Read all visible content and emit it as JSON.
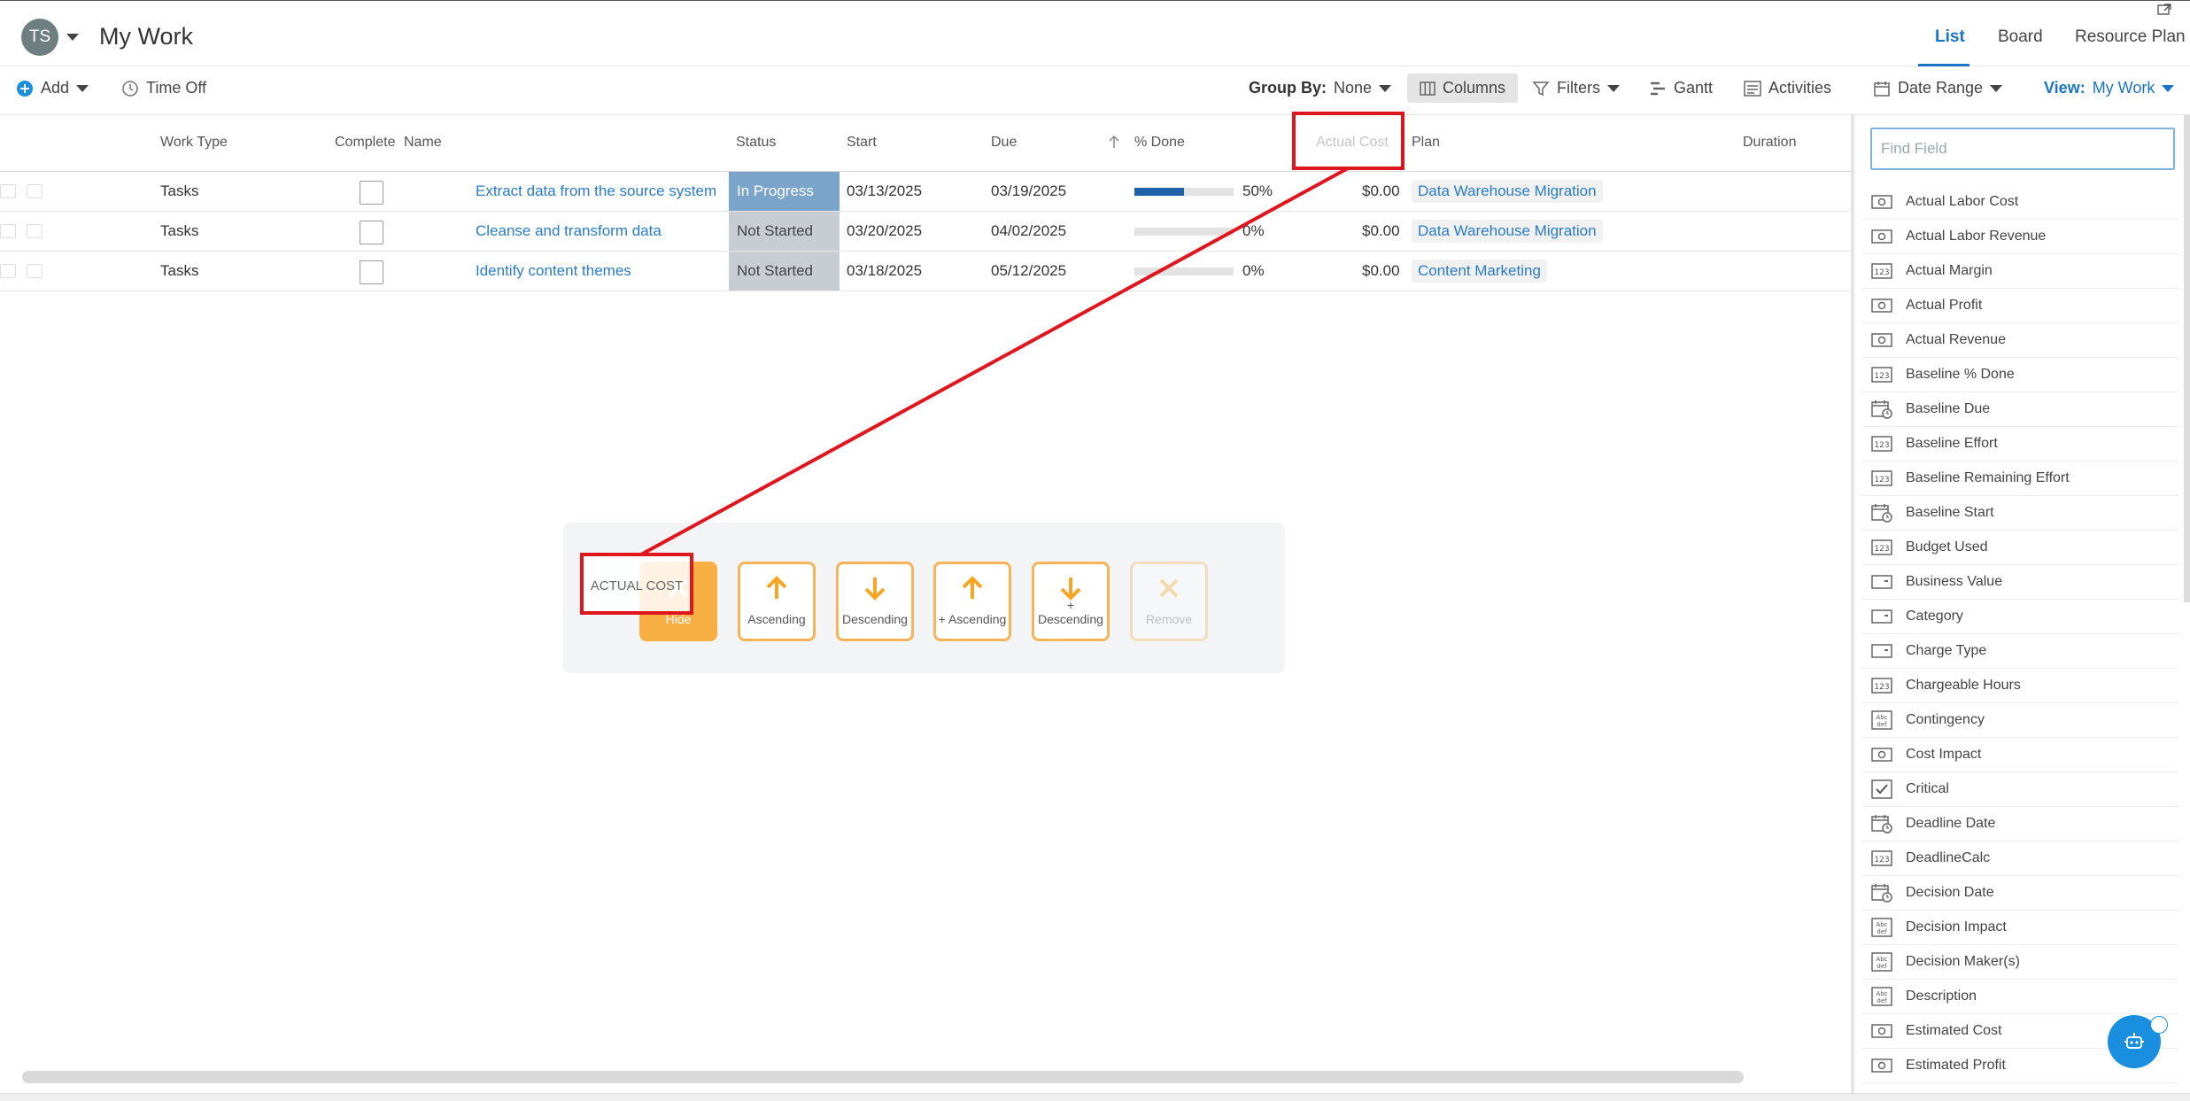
{
  "header": {
    "avatar_initials": "TS",
    "title": "My Work",
    "view_tabs": [
      "List",
      "Board",
      "Resource Plan"
    ],
    "active_tab": "List"
  },
  "toolbar": {
    "add": "Add",
    "time_off": "Time Off",
    "group_by_label": "Group By:",
    "group_by_value": "None",
    "columns": "Columns",
    "filters": "Filters",
    "gantt": "Gantt",
    "activities": "Activities",
    "date_range": "Date Range",
    "view_label": "View:",
    "view_value": "My Work"
  },
  "columns": {
    "work_type": "Work Type",
    "complete": "Complete",
    "name": "Name",
    "status": "Status",
    "start": "Start",
    "due": "Due",
    "pct_done": "% Done",
    "actual_cost": "Actual Cost",
    "plan": "Plan",
    "duration": "Duration"
  },
  "rows": [
    {
      "work_type": "Tasks",
      "name": "Extract data from the source system",
      "status": "In Progress",
      "start": "03/13/2025",
      "due": "03/19/2025",
      "pct": "50%",
      "pct_value": 0.5,
      "cost": "$0.00",
      "plan": "Data Warehouse Migration"
    },
    {
      "work_type": "Tasks",
      "name": "Cleanse and transform data",
      "status": "Not Started",
      "start": "03/20/2025",
      "due": "04/02/2025",
      "pct": "0%",
      "pct_value": 0,
      "cost": "$0.00",
      "plan": "Data Warehouse Migration"
    },
    {
      "work_type": "Tasks",
      "name": "Identify content themes",
      "status": "Not Started",
      "start": "03/18/2025",
      "due": "05/12/2025",
      "pct": "0%",
      "pct_value": 0,
      "cost": "$0.00",
      "plan": "Content Marketing"
    }
  ],
  "field_panel": {
    "search_placeholder": "Find Field",
    "fields": [
      {
        "label": "Actual Labor Cost",
        "icon": "money-icon"
      },
      {
        "label": "Actual Labor Revenue",
        "icon": "money-icon"
      },
      {
        "label": "Actual Margin",
        "icon": "number-icon"
      },
      {
        "label": "Actual Profit",
        "icon": "money-icon"
      },
      {
        "label": "Actual Revenue",
        "icon": "money-icon"
      },
      {
        "label": "Baseline % Done",
        "icon": "number-icon"
      },
      {
        "label": "Baseline Due",
        "icon": "calendar-icon"
      },
      {
        "label": "Baseline Effort",
        "icon": "number-icon"
      },
      {
        "label": "Baseline Remaining Effort",
        "icon": "number-icon"
      },
      {
        "label": "Baseline Start",
        "icon": "calendar-icon"
      },
      {
        "label": "Budget Used",
        "icon": "number-icon"
      },
      {
        "label": "Business Value",
        "icon": "dropdown-icon"
      },
      {
        "label": "Category",
        "icon": "dropdown-icon"
      },
      {
        "label": "Charge Type",
        "icon": "dropdown-icon"
      },
      {
        "label": "Chargeable Hours",
        "icon": "number-icon"
      },
      {
        "label": "Contingency",
        "icon": "text-icon"
      },
      {
        "label": "Cost Impact",
        "icon": "money-icon"
      },
      {
        "label": "Critical",
        "icon": "checkbox-icon"
      },
      {
        "label": "Deadline Date",
        "icon": "calendar-icon"
      },
      {
        "label": "DeadlineCalc",
        "icon": "number-icon"
      },
      {
        "label": "Decision Date",
        "icon": "calendar-icon"
      },
      {
        "label": "Decision Impact",
        "icon": "text-icon"
      },
      {
        "label": "Decision Maker(s)",
        "icon": "text-icon"
      },
      {
        "label": "Description",
        "icon": "text-icon"
      },
      {
        "label": "Estimated Cost",
        "icon": "money-icon"
      },
      {
        "label": "Estimated Profit",
        "icon": "money-icon"
      }
    ]
  },
  "sort_overlay": {
    "drag_label": "ACTUAL COST",
    "buttons": [
      "Hide",
      "Ascending",
      "Descending",
      "+ Ascending",
      "+ Descending",
      "Remove"
    ]
  },
  "colors": {
    "accent": "#1a73c8",
    "in_progress": "#7ba4ca",
    "not_started": "#c8ccd3",
    "sort_orange": "#f5b45a",
    "highlight_red": "#e0161e"
  }
}
